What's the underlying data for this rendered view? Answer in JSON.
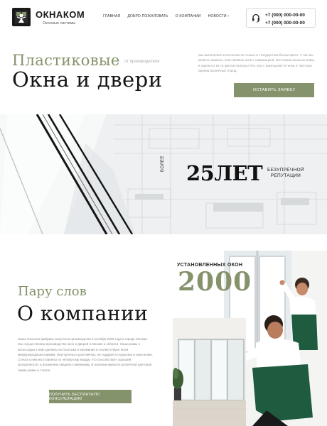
{
  "header": {
    "brand": "ОКНАКОМ",
    "tagline": "Оконные системы",
    "nav": [
      "ГЛАВНАЯ",
      "ДОБРО ПОЖАЛОВАТЬ",
      "О КОМПАНИИ",
      "НОВОСТИ"
    ],
    "nav_more": "‹",
    "phones": [
      "+7 (000) 000-00-00",
      "+7 (000) 000-00-00"
    ]
  },
  "hero": {
    "line1": "Пластиковые",
    "small": "от производителя",
    "line2": "Окна и двери",
    "description": "Мы выполняем остекление не только в стандартном белом цвете. У нас вы можете заказать пластиковые окна с ламинацией. Изготовим оконные рамы в одном из 16 ти цветов палитры RAL или с имитацией оттенка и текстуры дерева различных пород.",
    "button": "ОСТАВИТЬ ЗАЯВКУ"
  },
  "banner": {
    "prefix": "БОЛЕЕ",
    "number": "25ЛЕТ",
    "note_line1": "БЕЗУПРЕЧНОЙ",
    "note_line2": "РЕПУТАЦИИ"
  },
  "about": {
    "line1": "Пару слов",
    "line2": "О компании",
    "description": "Наша Оконная фабрика запустила производство 5 октября 2006 года в городе Москва. Мы осуществляем производство окон и дверей в Москве и области. Наши рамы и аксессуары к ним сделаны из пластика и алюминия и соответствуют всем международным нормам. Они прочны и долговечны, не поддаются коррозии и окислению. Стекла к ним изготовлены по четвёртому квадру, что способствует хорошей прозрачности, а искажение сведено к минимуму. В наличии имеются различной цветовой гаммы рамы и стекла.",
    "button": "ПОЛУЧИТЬ БЕСПЛАТНУЮ КОНСУЛЬТАЦИЮ"
  },
  "stats": {
    "label": "УСТАНОВЛЕННЫХ ОКОН",
    "number": "2000"
  },
  "colors": {
    "accent": "#84936b",
    "dark": "#151515"
  }
}
